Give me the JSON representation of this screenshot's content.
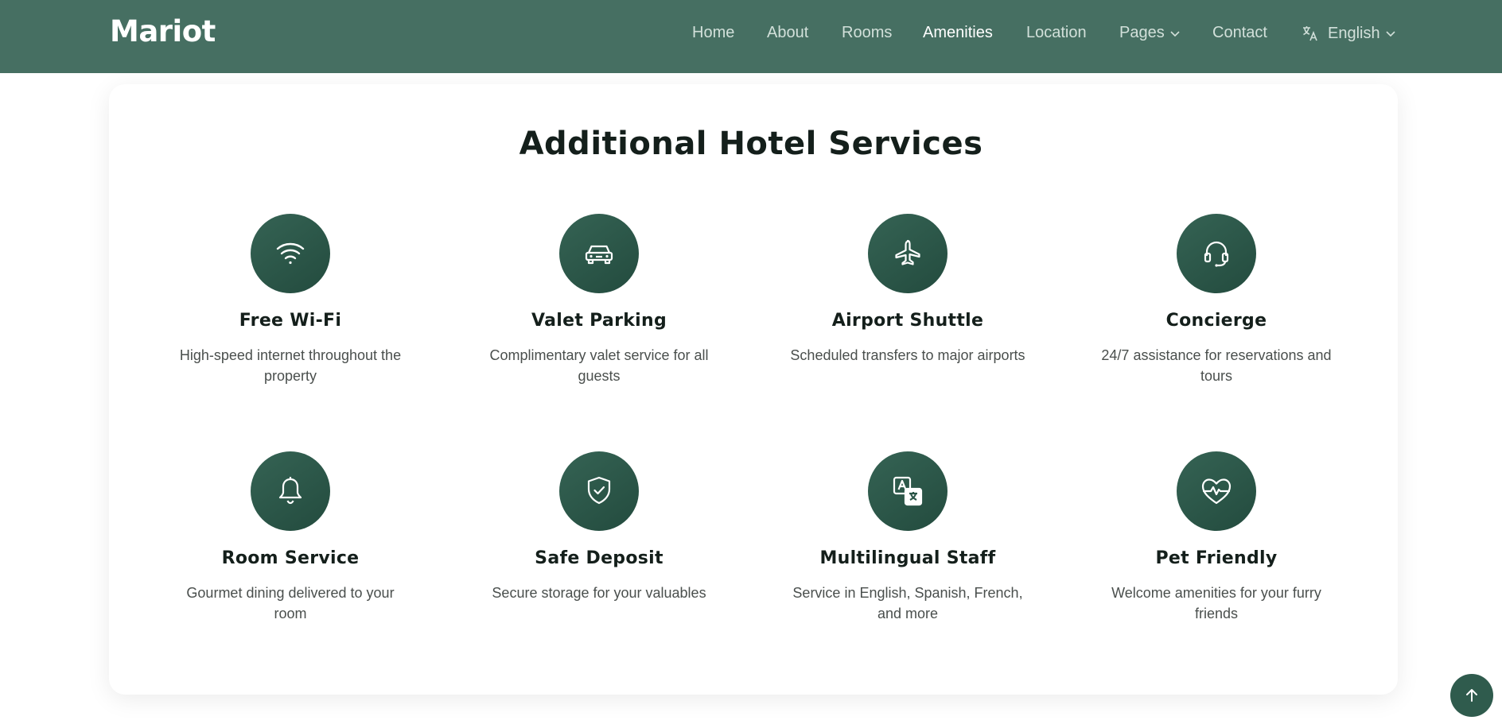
{
  "brand": {
    "logo": "Mariot"
  },
  "nav": {
    "items": [
      {
        "label": "Home",
        "active": false
      },
      {
        "label": "About",
        "active": false
      },
      {
        "label": "Rooms",
        "active": false
      },
      {
        "label": "Amenities",
        "active": true
      },
      {
        "label": "Location",
        "active": false
      },
      {
        "label": "Pages",
        "active": false,
        "dropdown": true
      },
      {
        "label": "Contact",
        "active": false
      }
    ],
    "language": {
      "label": "English",
      "icon": "translate-icon"
    }
  },
  "section": {
    "title": "Additional Hotel Services",
    "services": [
      {
        "title": "Free Wi-Fi",
        "description": "High-speed internet throughout the property",
        "icon": "wifi-icon"
      },
      {
        "title": "Valet Parking",
        "description": "Complimentary valet service for all guests",
        "icon": "car-icon"
      },
      {
        "title": "Airport Shuttle",
        "description": "Scheduled transfers to major airports",
        "icon": "airplane-icon"
      },
      {
        "title": "Concierge",
        "description": "24/7 assistance for reservations and tours",
        "icon": "headset-icon"
      },
      {
        "title": "Room Service",
        "description": "Gourmet dining delivered to your room",
        "icon": "bell-icon"
      },
      {
        "title": "Safe Deposit",
        "description": "Secure storage for your valuables",
        "icon": "shield-check-icon"
      },
      {
        "title": "Multilingual Staff",
        "description": "Service in English, Spanish, French, and more",
        "icon": "translate-icon"
      },
      {
        "title": "Pet Friendly",
        "description": "Welcome amenities for your furry friends",
        "icon": "heart-pulse-icon"
      }
    ]
  },
  "scroll_top": {
    "icon": "arrow-up-icon"
  },
  "colors": {
    "header_bg": "#466f62",
    "accent": "#2f5b4d",
    "title_text": "#141f1b"
  }
}
